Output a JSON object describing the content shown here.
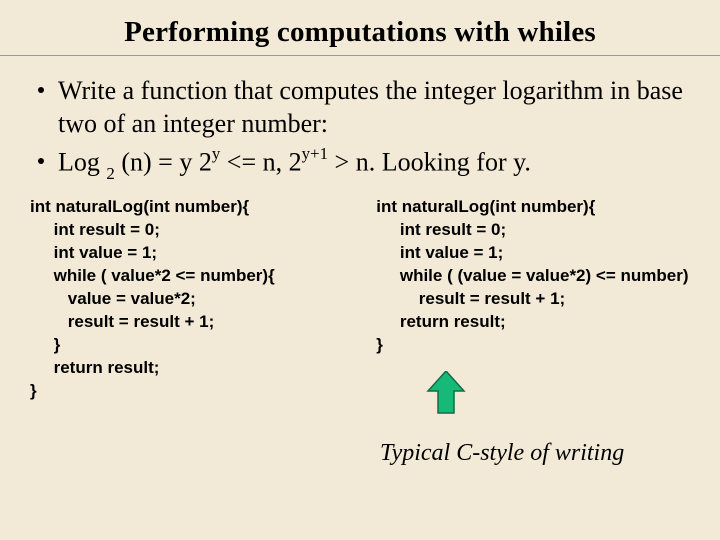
{
  "title": "Performing computations with whiles",
  "bullets": {
    "b1": "Write a function that computes the integer logarithm in base two of an integer number:",
    "b2_pre": "Log ",
    "b2_sub1": "2",
    "b2_a": " (n) = y   2",
    "b2_sup1": "y",
    "b2_b": " <= n, 2",
    "b2_sup2": "y+1",
    "b2_c": " > n. Looking for y."
  },
  "code_left": "int naturalLog(int number){\n     int result = 0;\n     int value = 1;\n     while ( value*2 <= number){\n        value = value*2;\n        result = result + 1;\n     }\n     return result;\n}",
  "code_right": "int naturalLog(int number){\n     int result = 0;\n     int value = 1;\n     while ( (value = value*2) <= number)\n         result = result + 1;\n     return result;\n}",
  "caption": "Typical C-style of writing",
  "colors": {
    "arrow_fill": "#17b978",
    "arrow_stroke": "#0b6e46"
  }
}
